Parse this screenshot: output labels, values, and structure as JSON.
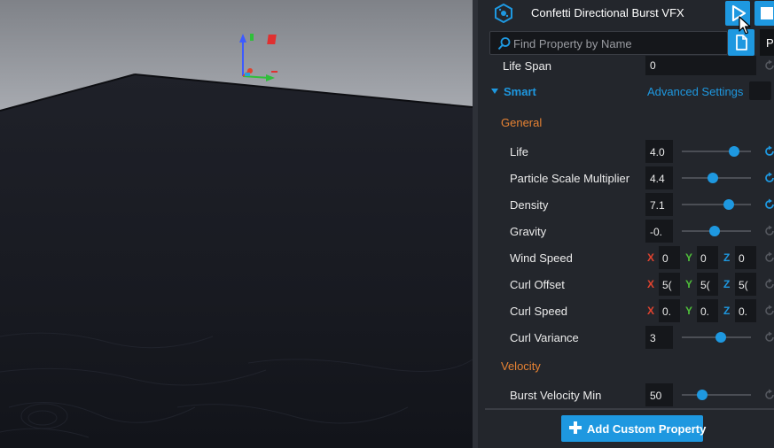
{
  "window": {
    "title": "Confetti Directional Burst VFX"
  },
  "toolbar": {
    "play_icon": "play-icon",
    "stop_icon": "stop-icon"
  },
  "search": {
    "placeholder": "Find Property by Name"
  },
  "tooltip": {
    "text": "Pla"
  },
  "colors": {
    "accent": "#1e98e0",
    "section": "#e68233",
    "axis_x": "#e0432f",
    "axis_y": "#4fbf3a",
    "axis_z": "#1e98e0"
  },
  "props": {
    "life_span": {
      "label": "Life Span",
      "value": "0"
    },
    "smart": {
      "label": "Smart",
      "advanced_label": "Advanced Settings"
    },
    "general_header": "General",
    "life": {
      "label": "Life",
      "value": "4.0",
      "level": 0.75
    },
    "particle_scale": {
      "label": "Particle Scale Multiplier",
      "value": "4.4",
      "level": 0.45
    },
    "density": {
      "label": "Density",
      "value": "7.1",
      "level": 0.68
    },
    "gravity": {
      "label": "Gravity",
      "value": "-0.",
      "level": 0.48
    },
    "wind_speed": {
      "label": "Wind Speed",
      "x": "0",
      "y": "0",
      "z": "0"
    },
    "curl_offset": {
      "label": "Curl Offset",
      "x": "5(",
      "y": "5(",
      "z": "5("
    },
    "curl_speed": {
      "label": "Curl Speed",
      "x": "0.",
      "y": "0.",
      "z": "0."
    },
    "curl_variance": {
      "label": "Curl Variance",
      "value": "3",
      "level": 0.57
    },
    "velocity_header": "Velocity",
    "burst_velocity_min": {
      "label": "Burst Velocity Min",
      "value": "50",
      "level": 0.3
    },
    "axis_labels": {
      "x": "X",
      "y": "Y",
      "z": "Z"
    }
  },
  "footer": {
    "add_label": "Add Custom Property"
  }
}
